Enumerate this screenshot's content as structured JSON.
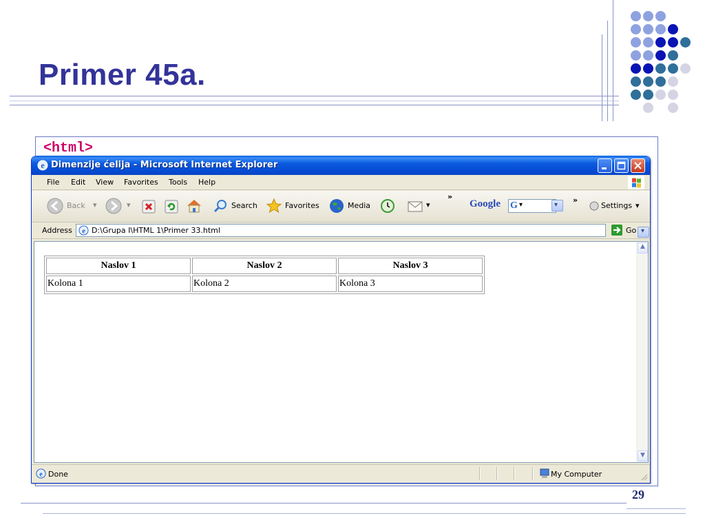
{
  "slide": {
    "title": "Primer 45a.",
    "code_snippet": "<html>",
    "page_number": "29"
  },
  "window": {
    "title": "Dimenzije ćelija - Microsoft Internet Explorer"
  },
  "menu": {
    "items": [
      "File",
      "Edit",
      "View",
      "Favorites",
      "Tools",
      "Help"
    ]
  },
  "toolbar": {
    "back_label": "Back",
    "search_label": "Search",
    "favorites_label": "Favorites",
    "media_label": "Media",
    "more_label": "»",
    "google_label": "Google",
    "google_more": "»",
    "settings_label": "Settings"
  },
  "address": {
    "label": "Address",
    "value": "D:\\Grupa I\\HTML 1\\Primer 33.html",
    "go_label": "Go"
  },
  "page_table": {
    "headers": [
      "Naslov 1",
      "Naslov 2",
      "Naslov 3"
    ],
    "rows": [
      [
        "Kolona 1",
        "Kolona 2",
        "Kolona 3"
      ]
    ]
  },
  "status": {
    "text": "Done",
    "zone": "My Computer"
  },
  "colors": {
    "title": "#33339a",
    "code": "#cc0066",
    "ie_titlebar": "#0549d0"
  }
}
